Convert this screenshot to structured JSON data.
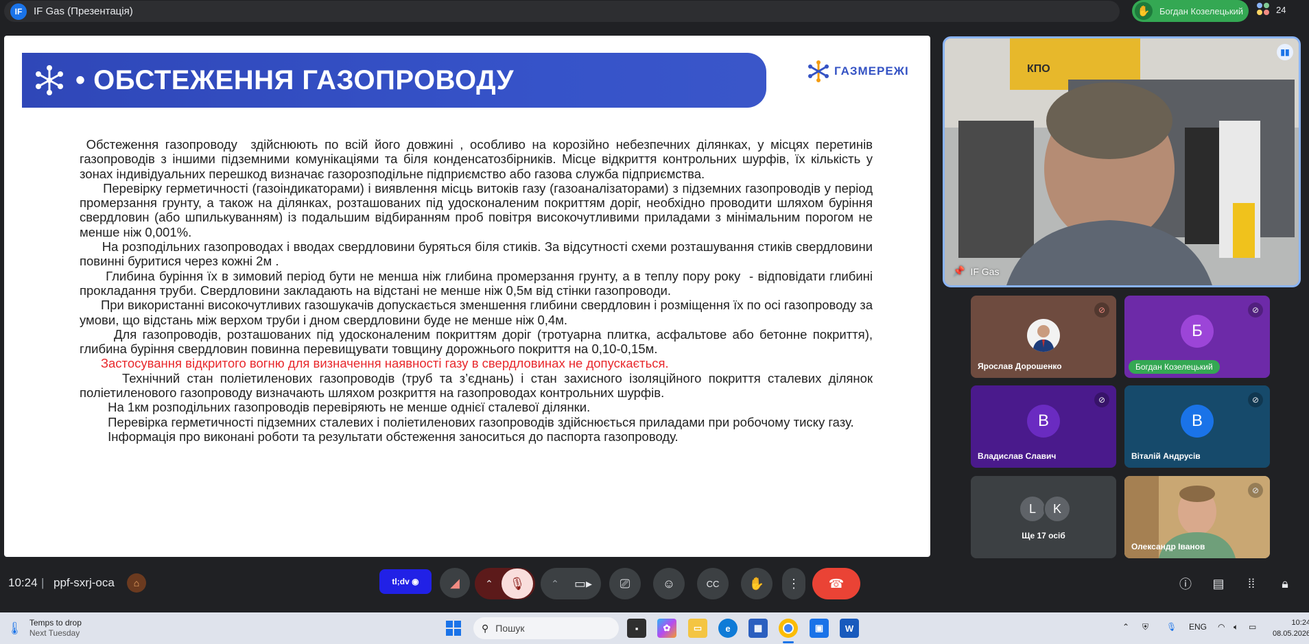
{
  "meeting": {
    "presentation_title": "IF Gas (Презентація)",
    "presentation_avatar": "IF",
    "active_speaker": "Богдан Козелецький",
    "participant_count": "24",
    "time": "10:24",
    "separator": "|",
    "code": "ppf-sxrj-oca"
  },
  "slide": {
    "title": "• ОБСТЕЖЕННЯ ГАЗОПРОВОДУ",
    "logo_text": "ГАЗМЕРЕЖІ",
    "paragraphs": [
      " Обстеження газопроводу  здійснюють по всій його довжині , особливо на корозійно небезпечних ділянках, у місцях перетинів газопроводів з іншими підземними комунікаціями та біля конденсатозбірників. Місце відкриття контрольних шурфів, їх кількість у зонах індивідуальних перешкод визначає газорозподільне підприємство або газова служба підприємства.",
      "      Перевірку герметичності (газоіндикаторами) і виявлення місць витоків газу (газоаналізаторами) з підземних газопроводів у період промерзання грунту, а також на ділянках, розташованих під удосконаленим покриттям доріг, необхідно проводити шляхом буріння свердловин (або шпилькуванням) із подальшим відбиранням проб повітря високочутливими приладами з мінімальним порогом не менше ніж 0,001%.",
      "      На розподільних газопроводах і вводах свердловини буряться біля стиків. За відсутності схеми розташування стиків свердловини повинні буритися через кожні 2м .",
      "      Глибина буріння їх в зимовий період бути не менша ніж глибина промерзання грунту, а в теплу пору року  - відповідати глибині прокладання труби. Свердловини закладають на відстані не менше ніж 0,5м від стінки газопроводи.",
      "      При використанні високочутливих газошукачів допускається зменшення глибини свердловин і розміщення їх по осі газопроводу за умови, що відстань між верхом труби і дном свердловини буде не менше ніж 0,4м.",
      "      Для газопроводів, розташованих під удосконаленим покриттям доріг (тротуарна плитка, асфальтове або бетонне покриття), глибина буріння свердловин повинна перевищувати товщину дорожнього покриття на 0,10-0,15м.",
      "      Застосування відкритого вогню для визначення наявності газу в свердловинах не допускається.",
      "      Технічний стан поліетиленових газопроводів (труб та з’єднань) і стан захисного ізоляційного покриття сталевих ділянок поліетиленового газопроводу визначають шляхом розкриття на газопроводах контрольних шурфів.",
      "        На 1км розподільних газопроводів перевіряють не менше однієї сталевої ділянки.",
      "        Перевірка герметичності підземних сталевих і поліетиленових газопроводів здійснюється приладами при робочому тиску газу.",
      "        Інформація про виконані роботи та результати обстеження заноситься до паспорта газопроводу."
    ]
  },
  "main_tile": {
    "name": "IF Gas",
    "wall_sign": "КПО"
  },
  "tiles": [
    {
      "name": "Ярослав Дорошенко",
      "initial": ""
    },
    {
      "name": "Богдан Козелецький",
      "initial": "Б"
    },
    {
      "name": "Владислав Славич",
      "initial": "В"
    },
    {
      "name": "Віталій Андрусів",
      "initial": "В"
    },
    {
      "name": "Ще 17 осіб",
      "initial_1": "L",
      "initial_2": "K"
    },
    {
      "name": "Олександр Іванов"
    }
  ],
  "controls": {
    "tldv_label": "tl;dv"
  },
  "taskbar": {
    "weather_line1": "Temps to drop",
    "weather_line2": "Next Tuesday",
    "search_placeholder": "Пошук",
    "language": "ENG",
    "clock_time": "10:24",
    "clock_date": "08.05.2026"
  },
  "colors": {
    "accent_blue": "#8ab4f8",
    "speaker_green": "#34a853",
    "end_call_red": "#ea4335",
    "slide_banner_blue": "#3653c9",
    "warning_red_text": "#e8282c"
  }
}
